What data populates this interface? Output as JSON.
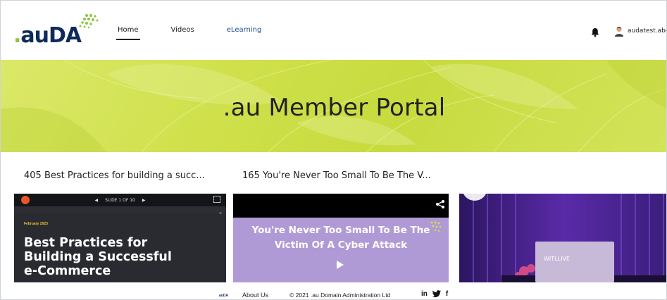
{
  "header": {
    "logo_text_dot": ".",
    "logo_text_main": "auDA",
    "nav": [
      {
        "label": "Home",
        "active": true
      },
      {
        "label": "Videos",
        "active": false
      },
      {
        "label": "eLearning",
        "active": false
      }
    ],
    "username": "audatest.abc",
    "icons": [
      "bell-icon",
      "user-avatar-icon"
    ]
  },
  "banner": {
    "title": ".au Member Portal"
  },
  "sections": [
    {
      "title": "405 Best Practices for building a succ..."
    },
    {
      "title": "165 You're Never Too Small To Be The V..."
    }
  ],
  "cards": {
    "card1": {
      "slide_counter": "SLIDE 1 OF 10",
      "date": "February 2023",
      "headline": "Best Practices for\nBuilding a Successful\ne-Commerce"
    },
    "card2": {
      "headline": "You're Never Too Small To Be The\nVictim Of A Cyber Attack"
    },
    "card3": {
      "stage_text": "WITLLIVE"
    }
  },
  "footer": {
    "logo_small": "auDA",
    "about": "About Us",
    "copyright": "© 2021 .au Domain Administration Ltd",
    "social": [
      "in",
      "twitter-icon",
      "f"
    ]
  },
  "colors": {
    "brand_navy": "#0f2b5b",
    "brand_green": "#8dc63f",
    "banner_lime": "#cfe04a",
    "card2_lavender": "#b09ad6"
  }
}
